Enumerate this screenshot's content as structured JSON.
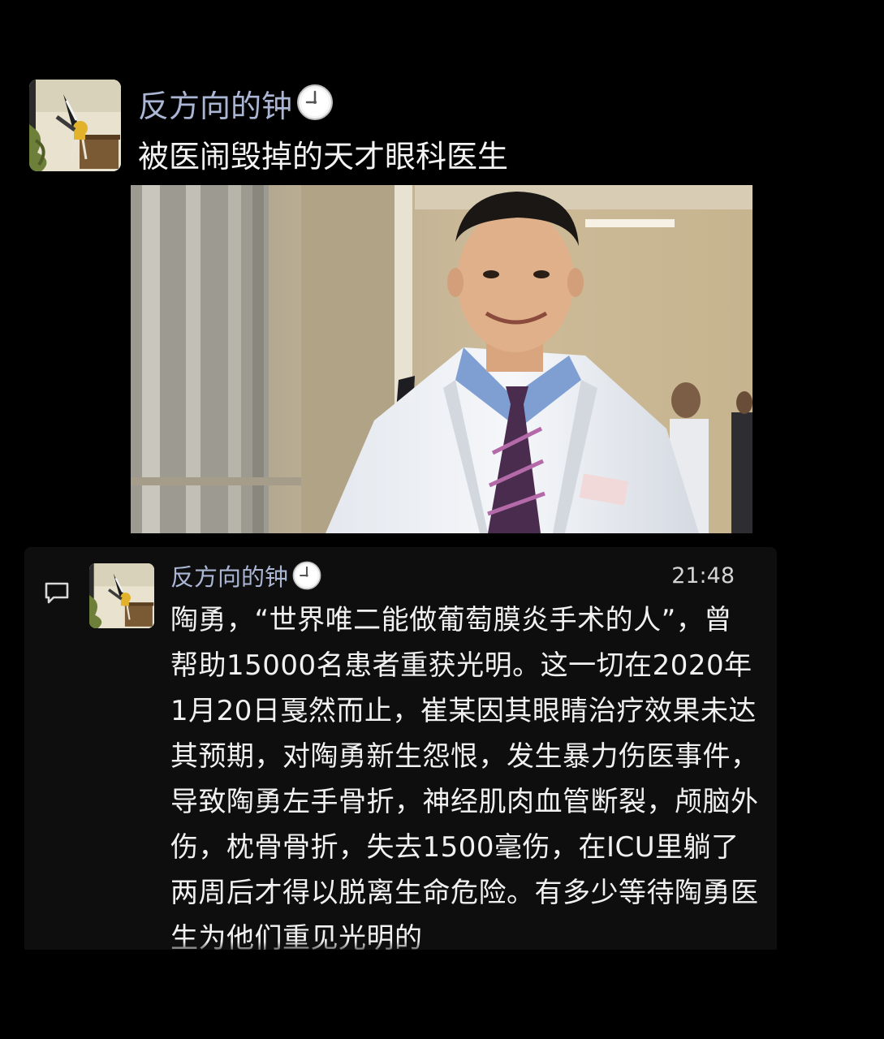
{
  "post": {
    "author": "反方向的钟",
    "author_badge_icon": "clock-emoji-icon",
    "title": "被医闹毁掉的天才眼科医生"
  },
  "comment": {
    "icon": "comment-bubble-icon",
    "author": "反方向的钟",
    "time": "21:48",
    "text": "陶勇，“世界唯二能做葡萄膜炎手术的人”，曾帮助15000名患者重获光明。这一切在2020年1月20日戛然而止，崔某因其眼睛治疗效果未达其预期，对陶勇新生怨恨，发生暴力伤医事件，导致陶勇左手骨折，神经肌肉血管断裂，颅脑外伤，枕骨骨折，失去1500毫伤，在ICU里躺了两周后才得以脱离生命危险。有多少等待陶勇医生为他们重见光明的"
  },
  "colors": {
    "background": "#000000",
    "username": "#aab6d4",
    "text": "#f1f1f1",
    "card": "#0e0e0e"
  }
}
